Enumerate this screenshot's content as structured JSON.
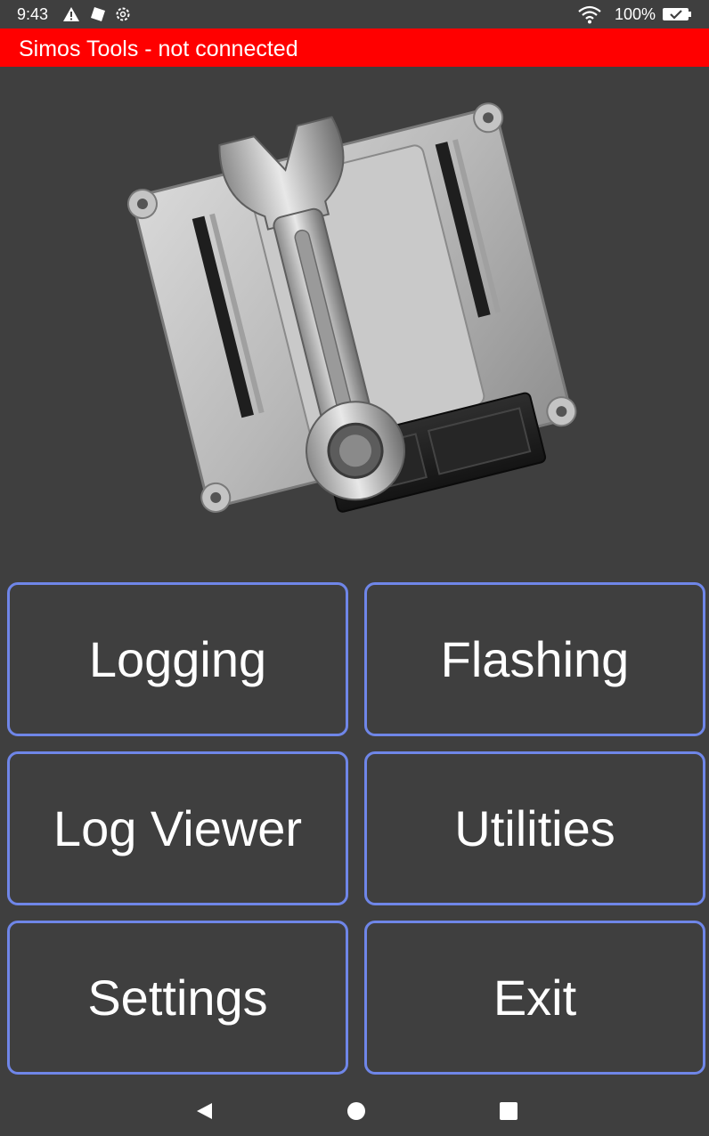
{
  "status_bar": {
    "time": "9:43",
    "battery_percent": "100%",
    "icons": [
      "warning-icon",
      "notification-icon",
      "settings-gear-icon",
      "wifi-icon",
      "battery-icon"
    ]
  },
  "title_bar": {
    "title": "Simos Tools - not connected",
    "color": "#ff0000"
  },
  "hero": {
    "icon": "ecu-wrench-icon"
  },
  "menu": {
    "buttons": [
      {
        "label": "Logging"
      },
      {
        "label": "Flashing"
      },
      {
        "label": "Log Viewer"
      },
      {
        "label": "Utilities"
      },
      {
        "label": "Settings"
      },
      {
        "label": "Exit"
      }
    ],
    "border_color": "#6f86e8"
  },
  "nav_bar": {
    "icons": [
      "back-icon",
      "home-icon",
      "recents-icon"
    ]
  }
}
